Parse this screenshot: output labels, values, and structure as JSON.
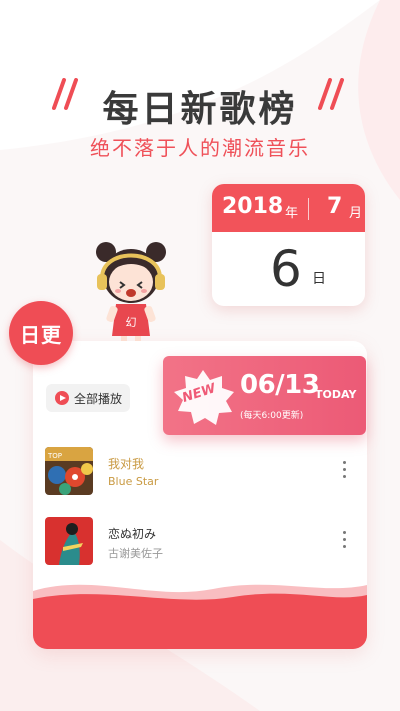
{
  "headline": "每日新歌榜",
  "subtitle": "绝不落于人的潮流音乐",
  "calendar": {
    "year": "2018",
    "year_unit": "年",
    "month": "7",
    "month_unit": "月",
    "day": "6",
    "day_unit": "日"
  },
  "badge": {
    "label": "日更"
  },
  "new_banner": {
    "tag": "NEW",
    "date": "06/13",
    "today": "TODAY",
    "note": "(每天6:00更新)"
  },
  "card": {
    "play_all": "全部播放",
    "songs": [
      {
        "title": "我对我",
        "artist": "Blue Star"
      },
      {
        "title": "恋ぬ初み",
        "artist": "古谢美佐子"
      }
    ]
  },
  "colors": {
    "accent": "#ef4d55",
    "gold_text": "#c99a43",
    "banner_pink": "#ec5a76"
  },
  "icons": [
    "play-icon",
    "more-icon",
    "slash-decoration",
    "mascot-illustration"
  ]
}
